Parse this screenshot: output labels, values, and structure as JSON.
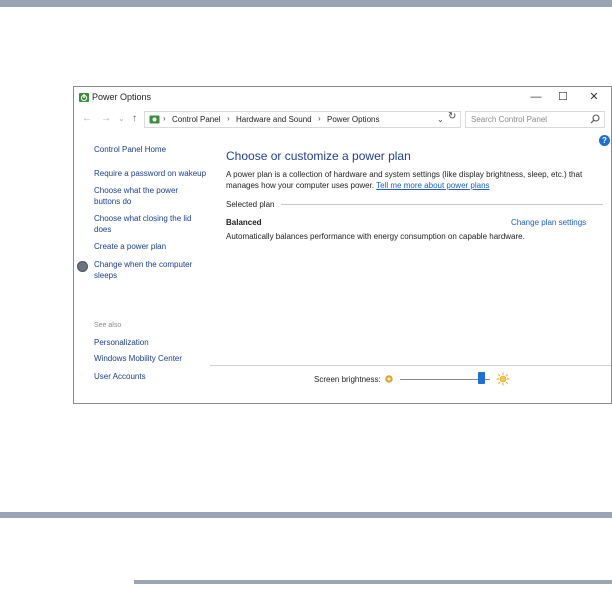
{
  "window": {
    "title": "Power Options",
    "controls": {
      "minimize": "—",
      "maximize": "☐",
      "close": "✕"
    }
  },
  "address_bar": {
    "back": "←",
    "forward": "→",
    "recent": "⌄",
    "up": "↑",
    "breadcrumbs": [
      "Control Panel",
      "Hardware and Sound",
      "Power Options"
    ],
    "separator": "›",
    "dropdown": "⌄",
    "refresh": "↻",
    "search_placeholder": "Search Control Panel"
  },
  "help": {
    "label": "?"
  },
  "sidebar": {
    "items": [
      "Control Panel Home",
      "Require a password on wakeup",
      "Choose what the power",
      "buttons do",
      "Choose what closing the lid",
      "does",
      "Create a power plan",
      "Change when the computer",
      "sleeps"
    ],
    "see_also_label": "See also",
    "see_also": [
      "Personalization",
      "Windows Mobility Center",
      "User Accounts"
    ]
  },
  "main": {
    "title": "Choose or customize a power plan",
    "description": "A power plan is a collection of hardware and system settings (like display brightness, sleep, etc.) that manages how your computer uses power.",
    "learn_more": "Tell me more about power plans",
    "selected_plan_label": "Selected plan",
    "plan": {
      "name": "Balanced",
      "description": "Automatically balances performance with energy consumption on capable hardware.",
      "settings_link": "Change plan settings"
    }
  },
  "brightness": {
    "label": "Screen brightness:",
    "level": 0.9
  },
  "colors": {
    "accent": "#1e6fd9",
    "heading": "#1e3f9a",
    "link": "#1b5fc7",
    "rule": "#9aa4b2"
  },
  "icons": {
    "app": "power-options-icon",
    "search": "search-icon",
    "sleep": "moon-icon",
    "dim": "sun-dim-icon",
    "bright": "sun-bright-icon"
  }
}
